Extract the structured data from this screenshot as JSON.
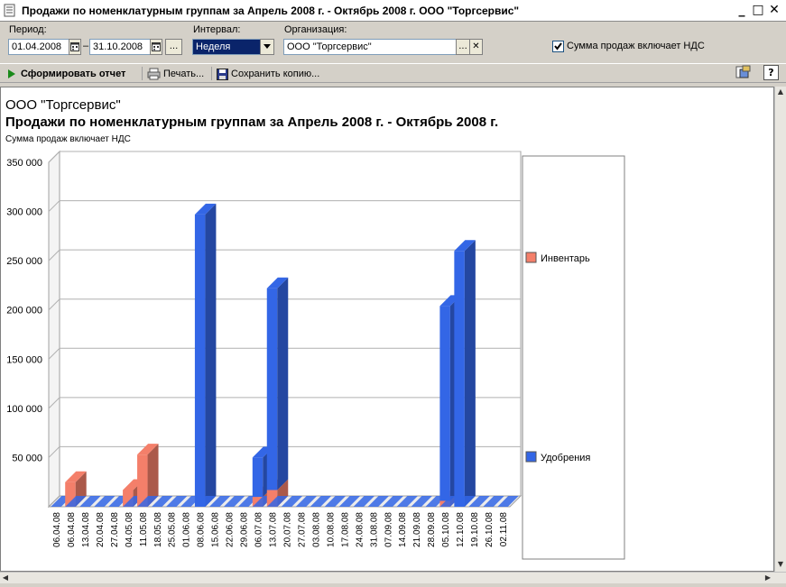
{
  "window": {
    "title": "Продажи по номенклатурным группам за Апрель 2008 г. - Октябрь 2008 г. ООО \"Торгсервис\"",
    "minimize": "_",
    "maximize": "□",
    "close": "✕"
  },
  "params": {
    "period_label": "Период:",
    "date_from": "01.04.2008",
    "date_sep": "–",
    "date_to": "31.10.2008",
    "period_more": "...",
    "interval_label": "Интервал:",
    "interval_value": "Неделя",
    "org_label": "Организация:",
    "org_value": "ООО \"Торгсервис\"",
    "org_more": "...",
    "org_clear": "✕",
    "vat_checkbox_label": "Сумма продаж включает НДС",
    "vat_checked": true
  },
  "toolbar": {
    "generate_label": "Сформировать отчет",
    "print_label": "Печать...",
    "save_label": "Сохранить копию...",
    "help_label": "?"
  },
  "report": {
    "organization": "ООО \"Торгсервис\"",
    "title": "Продажи по номенклатурным группам за Апрель 2008 г. - Октябрь 2008 г.",
    "note": "Сумма продаж включает НДС"
  },
  "colors": {
    "inventory": "#f47f6a",
    "fertilizer": "#3366e6"
  },
  "chart_data": {
    "type": "bar",
    "stacked": true,
    "three_d": true,
    "grid": true,
    "legend_position": "right",
    "ylim": [
      0,
      350000
    ],
    "y_ticks": [
      "350 000",
      "300 000",
      "250 000",
      "200 000",
      "150 000",
      "100 000",
      "50 000"
    ],
    "y_tick_values": [
      350000,
      300000,
      250000,
      200000,
      150000,
      100000,
      50000
    ],
    "categories": [
      "06.04.08",
      "06.04.08",
      "13.04.08",
      "20.04.08",
      "27.04.08",
      "04.05.08",
      "11.05.08",
      "18.05.08",
      "25.05.08",
      "01.06.08",
      "08.06.08",
      "15.06.08",
      "22.06.08",
      "29.06.08",
      "06.07.08",
      "13.07.08",
      "20.07.08",
      "27.07.08",
      "03.08.08",
      "10.08.08",
      "17.08.08",
      "24.08.08",
      "31.08.08",
      "07.09.08",
      "14.09.08",
      "21.09.08",
      "28.09.08",
      "05.10.08",
      "12.10.08",
      "19.10.08",
      "26.10.08",
      "02.11.08"
    ],
    "series": [
      {
        "name": "Инвентарь",
        "values": [
          0,
          25000,
          0,
          0,
          0,
          17000,
          53000,
          0,
          0,
          0,
          0,
          0,
          0,
          0,
          10000,
          17000,
          0,
          0,
          0,
          0,
          0,
          0,
          0,
          0,
          0,
          0,
          0,
          6000,
          0,
          0,
          0,
          0
        ]
      },
      {
        "name": "Удобрения",
        "values": [
          0,
          0,
          0,
          0,
          0,
          0,
          0,
          0,
          0,
          0,
          297000,
          0,
          0,
          0,
          40000,
          205000,
          0,
          0,
          0,
          0,
          0,
          0,
          0,
          0,
          0,
          0,
          0,
          198000,
          260000,
          0,
          0,
          0
        ]
      }
    ]
  }
}
